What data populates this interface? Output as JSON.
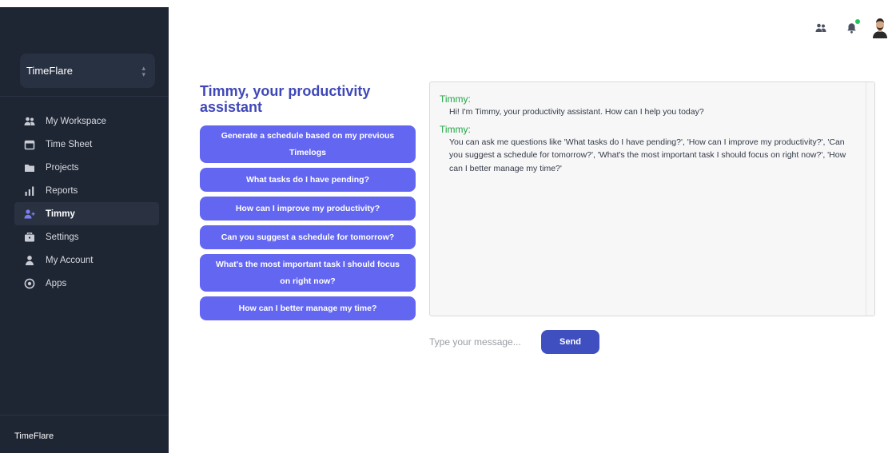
{
  "sidebar": {
    "org_name": "TimeFlare",
    "footer": "TimeFlare",
    "items": [
      {
        "label": "My Workspace",
        "icon": "users-icon"
      },
      {
        "label": "Time Sheet",
        "icon": "calendar-icon"
      },
      {
        "label": "Projects",
        "icon": "folder-icon"
      },
      {
        "label": "Reports",
        "icon": "bar-chart-icon"
      },
      {
        "label": "Timmy",
        "icon": "user-plus-icon",
        "active": true
      },
      {
        "label": "Settings",
        "icon": "briefcase-icon"
      },
      {
        "label": "My Account",
        "icon": "user-icon"
      },
      {
        "label": "Apps",
        "icon": "apps-icon"
      }
    ]
  },
  "header": {
    "icons": [
      "team-icon",
      "bell-icon",
      "avatar"
    ],
    "notification_dot_color": "#22c55e"
  },
  "assistant": {
    "title": "Timmy, your productivity assistant",
    "suggestions": [
      "Generate a schedule based on my previous Timelogs",
      "What tasks do I have pending?",
      "How can I improve my productivity?",
      "Can you suggest a schedule for tomorrow?",
      "What's the most important task I should focus on right now?",
      "How can I better manage my time?"
    ]
  },
  "chat": {
    "messages": [
      {
        "sender": "Timmy:",
        "text": "Hi! I'm Timmy, your productivity assistant. How can I help you today?"
      },
      {
        "sender": "Timmy:",
        "text": "You can ask me questions like 'What tasks do I have pending?', 'How can I improve my productivity?', 'Can you suggest a schedule for tomorrow?', 'What's the most important task I should focus on right now?', 'How can I better manage my time?'"
      }
    ],
    "input_placeholder": "Type your message...",
    "send_label": "Send"
  },
  "colors": {
    "sidebar_bg": "#1e2533",
    "accent": "#6366f1",
    "title": "#3f48b8",
    "sender": "#22a543",
    "send_button": "#3f4fc0"
  }
}
